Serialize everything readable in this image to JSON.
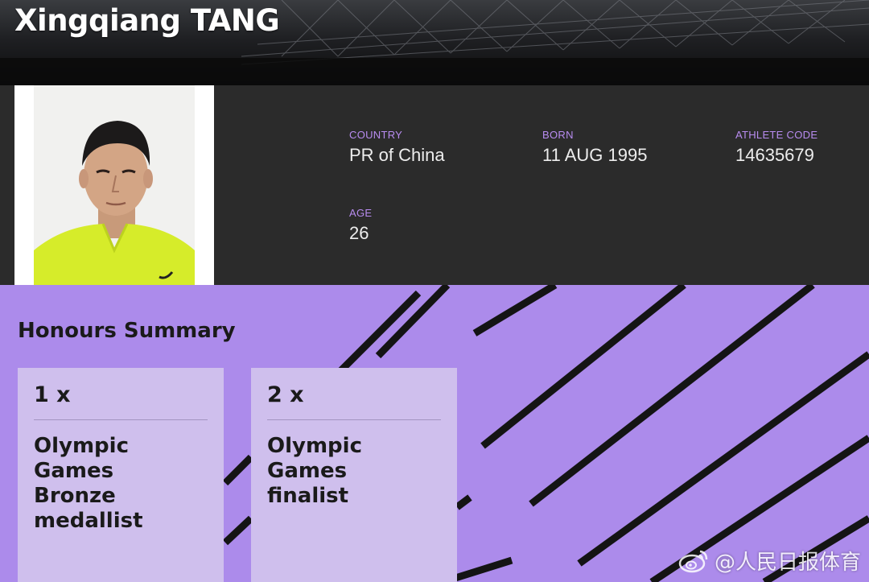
{
  "header": {
    "athlete_name": "Xingqiang TANG"
  },
  "profile": {
    "country_label": "COUNTRY",
    "country_value": "PR of China",
    "born_label": "BORN",
    "born_value": "11 AUG 1995",
    "code_label": "ATHLETE CODE",
    "code_value": "14635679",
    "age_label": "AGE",
    "age_value": "26"
  },
  "honours": {
    "title": "Honours Summary",
    "cards": [
      {
        "count": "1 x",
        "line1": "Olympic",
        "line2": "Games",
        "line3": "Bronze",
        "line4": "medallist"
      },
      {
        "count": "2 x",
        "line1": "Olympic",
        "line2": "Games",
        "line3": "finalist",
        "line4": ""
      }
    ]
  },
  "watermark": {
    "text": "@人民日报体育",
    "icon": "weibo-icon"
  },
  "colors": {
    "banner_dark": "#0c0c0d",
    "profile_bg": "#2b2b2b",
    "label_purple": "#b88cf0",
    "honours_bg": "#ac8beb",
    "card_bg": "#cfbfed"
  }
}
